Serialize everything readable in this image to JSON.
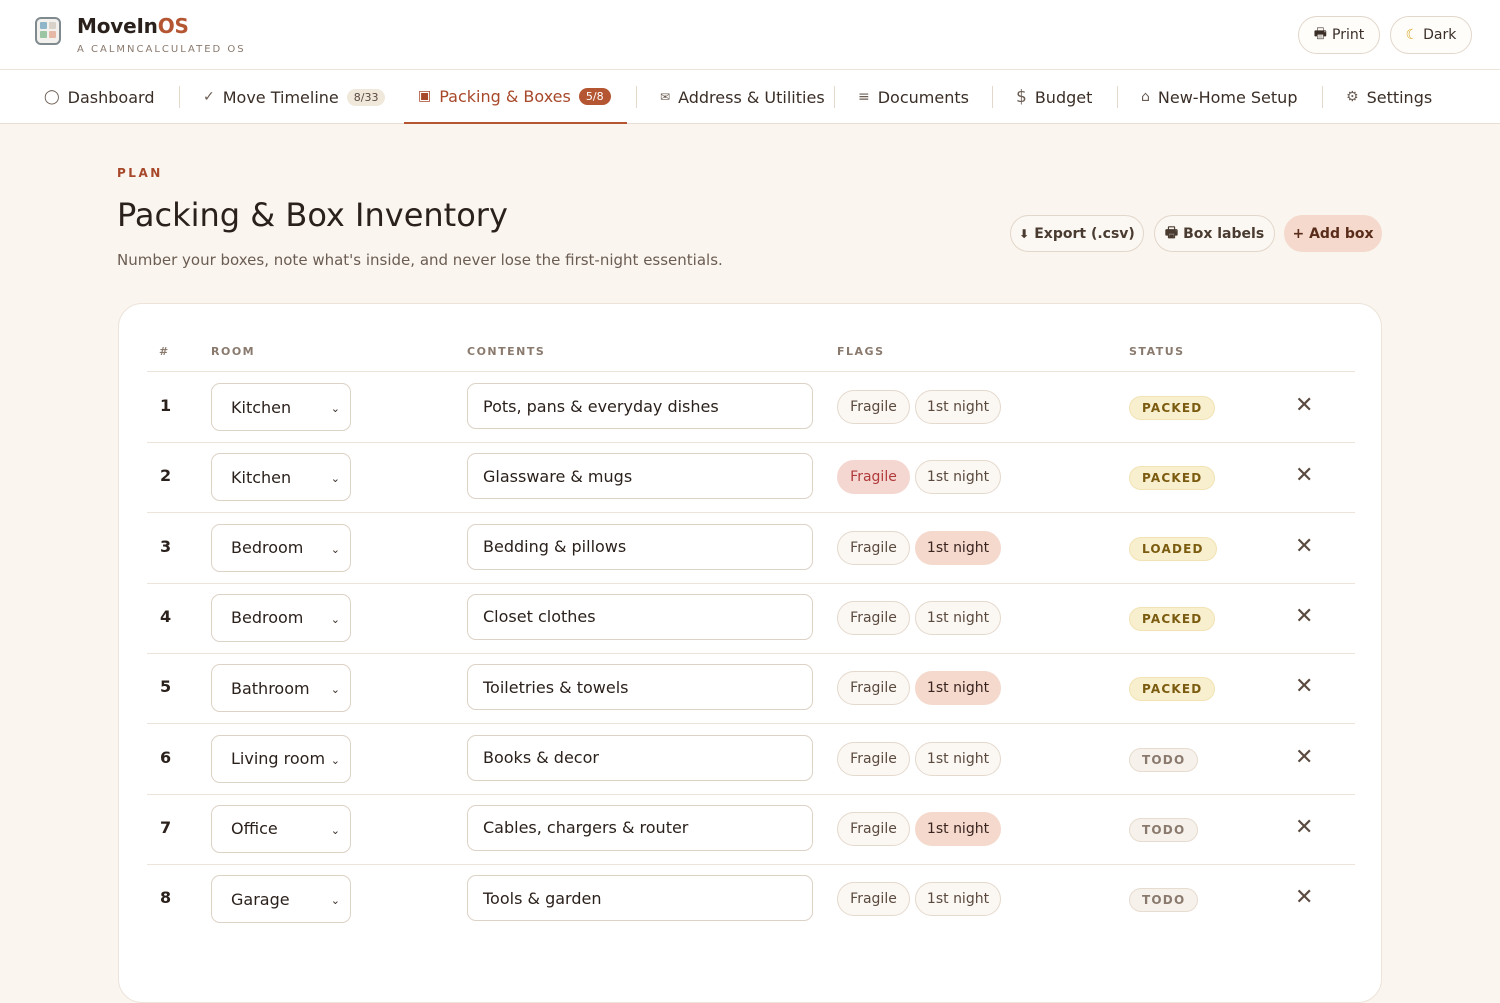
{
  "app": {
    "name_main": "MoveIn",
    "name_accent": "OS",
    "subtitle": "A CALMNCALCULATED OS"
  },
  "header_actions": {
    "print": "Print",
    "dark": "Dark"
  },
  "nav": {
    "tabs": [
      {
        "icon": "◯",
        "label": "Dashboard",
        "badge": ""
      },
      {
        "icon": "✓",
        "label": "Move Timeline",
        "badge": "8/33"
      },
      {
        "icon": "▣",
        "label": "Packing & Boxes",
        "badge": "5/8"
      },
      {
        "icon": "✉",
        "label": "Address & Utilities",
        "badge": ""
      },
      {
        "icon": "≡",
        "label": "Documents",
        "badge": ""
      },
      {
        "icon": "$",
        "label": "Budget",
        "badge": ""
      },
      {
        "icon": "⌂",
        "label": "New-Home Setup",
        "badge": ""
      },
      {
        "icon": "⚙",
        "label": "Settings",
        "badge": ""
      }
    ]
  },
  "page": {
    "eyebrow": "PLAN",
    "title": "Packing & Box Inventory",
    "description": "Number your boxes, note what's inside, and never lose the first-night essentials.",
    "export_label": "Export (.csv)",
    "labels_label": "Box labels",
    "add_label": "+ Add box"
  },
  "table": {
    "headers": {
      "num": "#",
      "room": "ROOM",
      "contents": "CONTENTS",
      "flags": "FLAGS",
      "status": "STATUS"
    },
    "flag_labels": {
      "fragile": "Fragile",
      "night": "1st night"
    },
    "rows": [
      {
        "num": "1",
        "room": "Kitchen",
        "contents": "Pots, pans & everyday dishes",
        "fragile": false,
        "night": false,
        "status": "PACKED"
      },
      {
        "num": "2",
        "room": "Kitchen",
        "contents": "Glassware & mugs",
        "fragile": true,
        "night": false,
        "status": "PACKED"
      },
      {
        "num": "3",
        "room": "Bedroom",
        "contents": "Bedding & pillows",
        "fragile": false,
        "night": true,
        "status": "LOADED"
      },
      {
        "num": "4",
        "room": "Bedroom",
        "contents": "Closet clothes",
        "fragile": false,
        "night": false,
        "status": "PACKED"
      },
      {
        "num": "5",
        "room": "Bathroom",
        "contents": "Toiletries & towels",
        "fragile": false,
        "night": true,
        "status": "PACKED"
      },
      {
        "num": "6",
        "room": "Living room",
        "contents": "Books & decor",
        "fragile": false,
        "night": false,
        "status": "TODO"
      },
      {
        "num": "7",
        "room": "Office",
        "contents": "Cables, chargers & router",
        "fragile": false,
        "night": true,
        "status": "TODO"
      },
      {
        "num": "8",
        "room": "Garage",
        "contents": "Tools & garden",
        "fragile": false,
        "night": false,
        "status": "TODO"
      }
    ]
  },
  "icons": {
    "delete": "✕",
    "chevron": "⌄",
    "printer": "🖶",
    "moon": "☾",
    "download": "⬇"
  },
  "colors": {
    "accent": "#b55632",
    "background": "#faf5ef",
    "fragile_on": "#f5d7d2",
    "night_on": "#f4d9cc"
  }
}
